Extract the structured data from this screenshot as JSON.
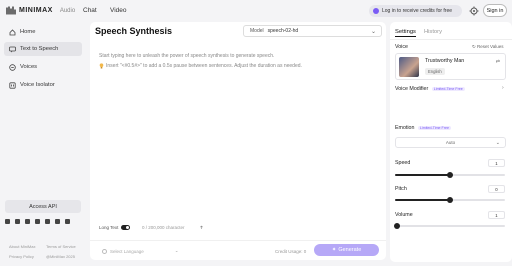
{
  "topbar": {
    "brand": "MINIMAX",
    "brand_sub": "Audio",
    "nav": [
      "Chat",
      "Video"
    ],
    "credits_button": "Log in to receive credits for free",
    "signin_label": "Sign in"
  },
  "sidebar": {
    "items": [
      {
        "label": "Home",
        "icon": "home-icon"
      },
      {
        "label": "Text to Speech",
        "icon": "speech-icon"
      },
      {
        "label": "Voices",
        "icon": "voices-icon"
      },
      {
        "label": "Voice Isolator",
        "icon": "isolator-icon"
      }
    ],
    "access_api": "Access API",
    "footer": [
      "About MiniMax",
      "Terms of Service",
      "Privacy Policy",
      "@MiniMax 2025"
    ]
  },
  "main": {
    "title": "Speech Synthesis",
    "model_label": "Model",
    "model_value": "speech-02-hd",
    "placeholder_line1": "Start typing here to unleash the power of speech synthesis to generate speech.",
    "placeholder_line2": "Insert \"<#0.5#>\" to add a 0.5s pause between sentences. Adjust the duration as needed.",
    "long_text_label": "Long Text",
    "char_count": "0 / 200,000 character",
    "language_placeholder": "Select Language",
    "credit_usage": "Credit Usage: 0",
    "generate_label": "Generate"
  },
  "panel": {
    "tabs": [
      "Settings",
      "History"
    ],
    "voice_label": "Voice",
    "reset_label": "Reset Values",
    "voice_name": "Trustworthy Man",
    "voice_language": "English",
    "voice_modifier_label": "Voice Modifier",
    "voice_modifier_badge": "Limited-Time Free",
    "emotion_label": "Emotion",
    "emotion_badge": "Limited-Time Free",
    "emotion_value": "Auto",
    "speed_label": "Speed",
    "speed_value": "1",
    "speed_level": 0.5,
    "pitch_label": "Pitch",
    "pitch_value": "0",
    "pitch_level": 0.5,
    "volume_label": "Volume",
    "volume_value": "1",
    "volume_level": 0.02
  },
  "colors": {
    "accent": "#7b5cf5",
    "generate_disabled": "#b6a8f7"
  }
}
